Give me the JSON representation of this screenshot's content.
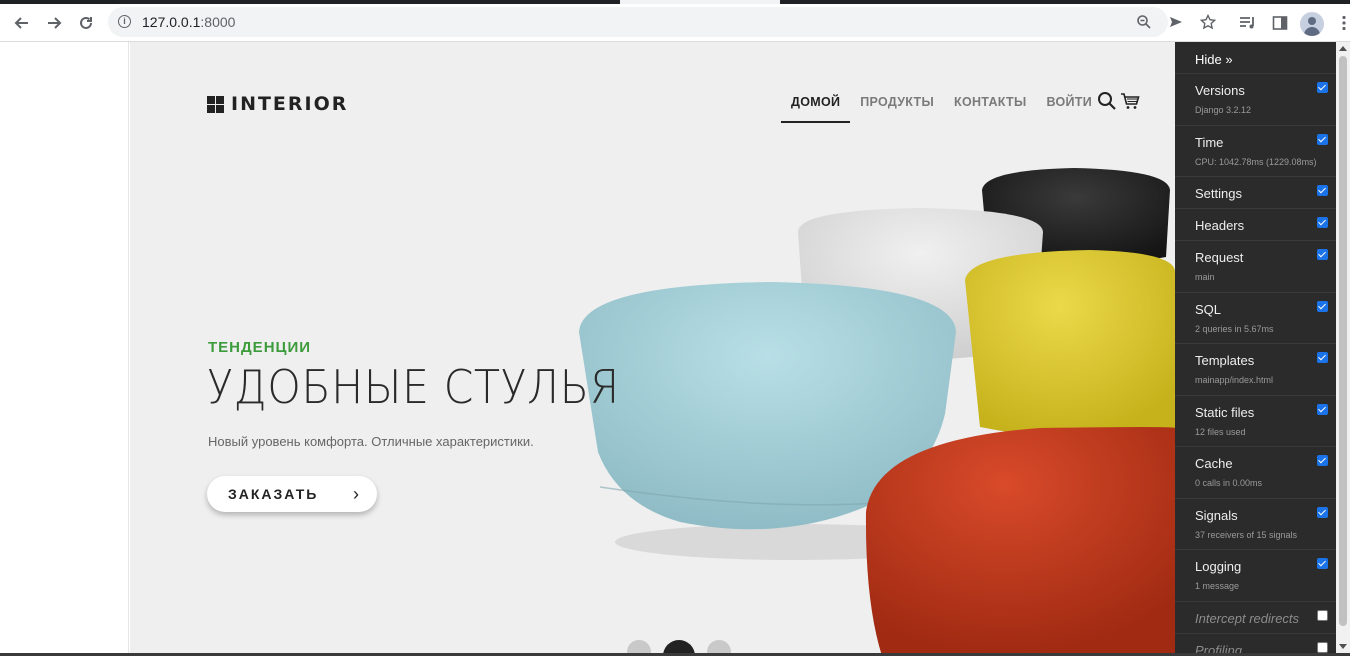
{
  "browser": {
    "url_host": "127.0.0.1",
    "url_port": ":8000"
  },
  "site": {
    "logo": "INTERIOR",
    "menu": [
      {
        "label": "ДОМОЙ"
      },
      {
        "label": "ПРОДУКТЫ"
      },
      {
        "label": "КОНТАКТЫ"
      },
      {
        "label": "ВОЙТИ"
      }
    ],
    "active_menu": "ДОМОЙ"
  },
  "hero": {
    "eyebrow": "ТЕНДЕНЦИИ",
    "headline": "УДОБНЫЕ СТУЛЬЯ",
    "subline": "Новый уровень комфорта. Отличные характеристики.",
    "cta": "ЗАКАЗАТЬ",
    "cta_arrow": "›",
    "slides_total": 3,
    "slide_active": 2,
    "colors": {
      "accent": "#3c9c3c",
      "pouf_blue": "#a9d3dc",
      "pouf_yellow": "#e3cf2d",
      "pouf_red": "#c43a1d",
      "pouf_white": "#e6e6e6",
      "pouf_black": "#262626"
    }
  },
  "debug_toolbar": {
    "hide": "Hide »",
    "panels": [
      {
        "title": "Versions",
        "sub": "Django 3.2.12",
        "checked": true
      },
      {
        "title": "Time",
        "sub": "CPU: 1042.78ms (1229.08ms)",
        "checked": true
      },
      {
        "title": "Settings",
        "sub": "",
        "checked": true
      },
      {
        "title": "Headers",
        "sub": "",
        "checked": true
      },
      {
        "title": "Request",
        "sub": "main",
        "checked": true
      },
      {
        "title": "SQL",
        "sub": "2 queries in 5.67ms",
        "checked": true
      },
      {
        "title": "Templates",
        "sub": "mainapp/index.html",
        "checked": true
      },
      {
        "title": "Static files",
        "sub": "12 files used",
        "checked": true
      },
      {
        "title": "Cache",
        "sub": "0 calls in 0.00ms",
        "checked": true
      },
      {
        "title": "Signals",
        "sub": "37 receivers of 15 signals",
        "checked": true
      },
      {
        "title": "Logging",
        "sub": "1 message",
        "checked": true
      },
      {
        "title": "Intercept redirects",
        "sub": "",
        "checked": false
      },
      {
        "title": "Profiling",
        "sub": "",
        "checked": false
      }
    ]
  }
}
